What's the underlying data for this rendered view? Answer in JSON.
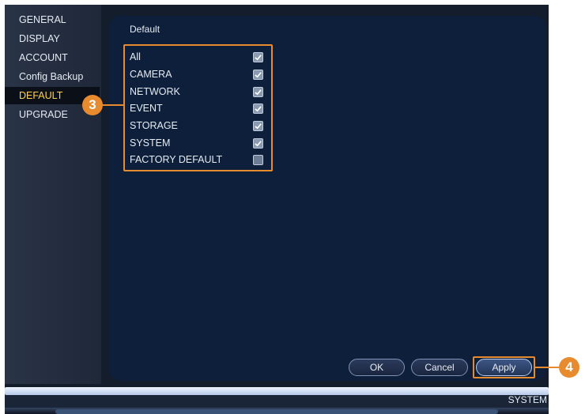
{
  "sidebar": {
    "items": [
      {
        "label": "GENERAL",
        "active": false
      },
      {
        "label": "DISPLAY",
        "active": false
      },
      {
        "label": "ACCOUNT",
        "active": false
      },
      {
        "label": "Config Backup",
        "active": false
      },
      {
        "label": "DEFAULT",
        "active": true
      },
      {
        "label": "UPGRADE",
        "active": false
      }
    ]
  },
  "main": {
    "title": "Default",
    "options": [
      {
        "label": "All",
        "checked": true
      },
      {
        "label": "CAMERA",
        "checked": true
      },
      {
        "label": "NETWORK",
        "checked": true
      },
      {
        "label": "EVENT",
        "checked": true
      },
      {
        "label": "STORAGE",
        "checked": true
      },
      {
        "label": "SYSTEM",
        "checked": true
      },
      {
        "label": "FACTORY DEFAULT",
        "checked": false
      }
    ]
  },
  "buttons": {
    "ok": "OK",
    "cancel": "Cancel",
    "apply": "Apply"
  },
  "callouts": {
    "step_options": "3",
    "step_apply": "4"
  },
  "footer": {
    "section_label": "SYSTEM"
  },
  "colors": {
    "callout": "#e88a2e",
    "active_nav_text": "#ffd24a",
    "panel_bg": "#0d1f3a"
  }
}
